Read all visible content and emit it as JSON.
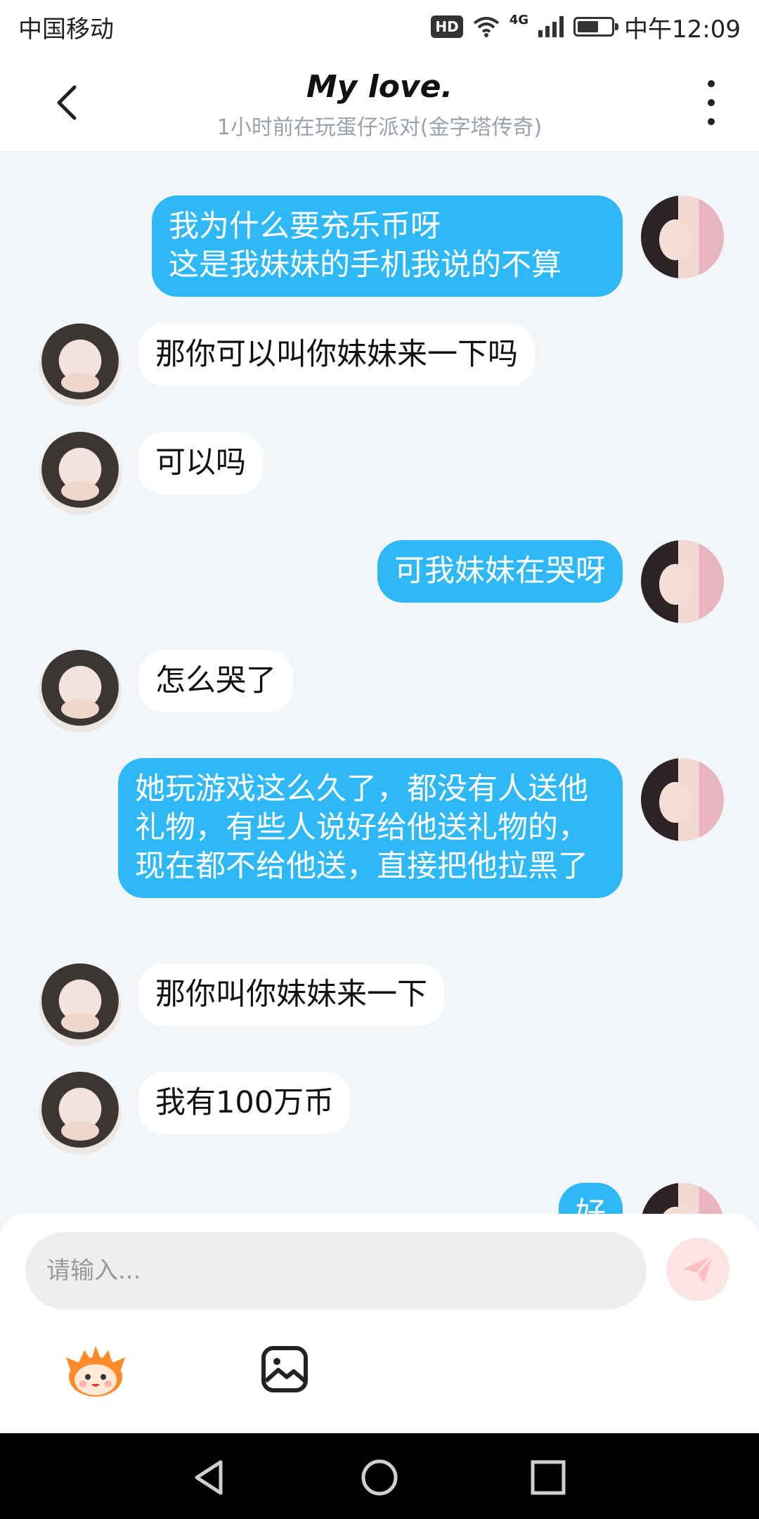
{
  "status_bar": {
    "carrier": "中国移动",
    "hd": "HD",
    "network": "4G",
    "time": "中午12:09"
  },
  "header": {
    "title": "My love.",
    "subtitle": "1小时前在玩蛋仔派对(金字塔传奇)"
  },
  "messages": [
    {
      "side": "right",
      "text": "我为什么要充乐币呀\n这是我妹妹的手机我说的不算"
    },
    {
      "side": "left",
      "text": "那你可以叫你妹妹来一下吗"
    },
    {
      "side": "left",
      "text": "可以吗"
    },
    {
      "side": "right",
      "text": "可我妹妹在哭呀"
    },
    {
      "side": "left",
      "text": "怎么哭了"
    },
    {
      "side": "right",
      "text": "她玩游戏这么久了，都没有人送他礼物，有些人说好给他送礼物的，现在都不给他送，直接把他拉黑了"
    },
    {
      "side": "left",
      "text": "那你叫你妹妹来一下"
    },
    {
      "side": "left",
      "text": "我有100万币"
    },
    {
      "side": "right",
      "text": "好"
    }
  ],
  "composer": {
    "placeholder": "请输入..."
  },
  "icons": {
    "back": "chevron-left-icon",
    "more": "more-vertical-icon",
    "send": "send-icon",
    "emoji": "eggy-face-icon",
    "image": "image-icon",
    "nav_back": "triangle-back-icon",
    "nav_home": "circle-home-icon",
    "nav_recents": "square-recents-icon"
  },
  "colors": {
    "accent_bubble": "#2eb8f6",
    "send_button": "#fde4e4"
  }
}
